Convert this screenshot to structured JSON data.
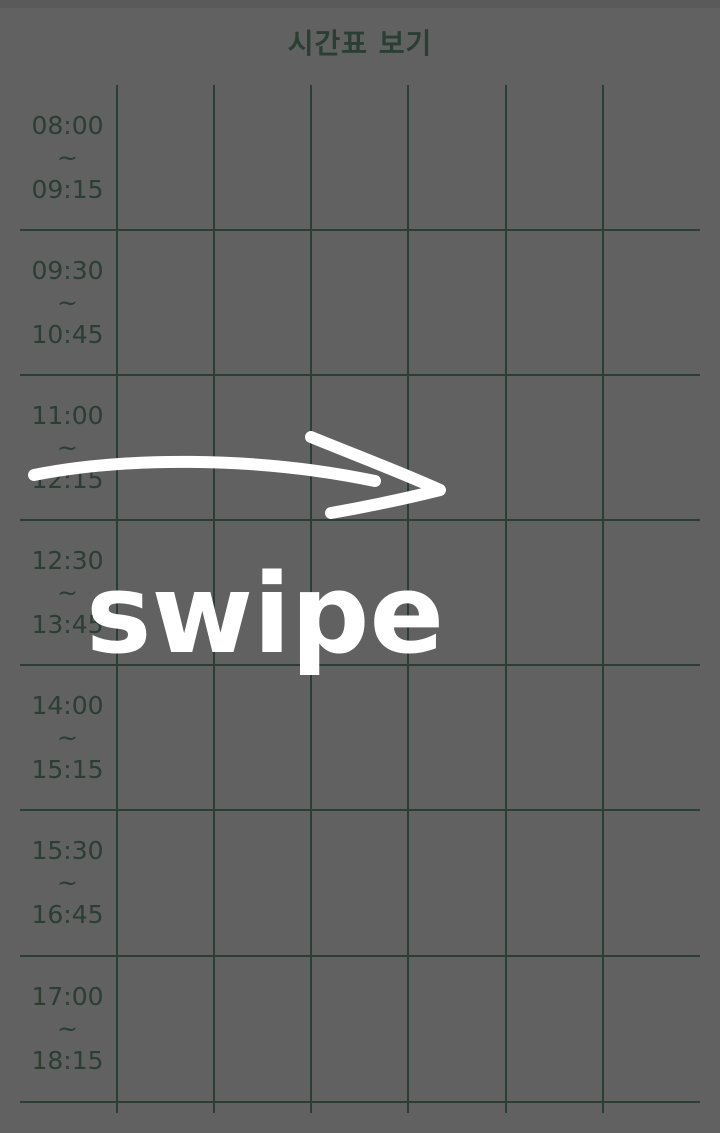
{
  "header": {
    "title": "시간표 보기"
  },
  "timetable": {
    "columns": 6,
    "slots": [
      {
        "start": "08:00",
        "sep": "~",
        "end": "09:15"
      },
      {
        "start": "09:30",
        "sep": "~",
        "end": "10:45"
      },
      {
        "start": "11:00",
        "sep": "~",
        "end": "12:15"
      },
      {
        "start": "12:30",
        "sep": "~",
        "end": "13:45"
      },
      {
        "start": "14:00",
        "sep": "~",
        "end": "15:15"
      },
      {
        "start": "15:30",
        "sep": "~",
        "end": "16:45"
      },
      {
        "start": "17:00",
        "sep": "~",
        "end": "18:15"
      }
    ]
  },
  "overlay": {
    "hint_text": "swipe",
    "arrow_icon": "swipe-right-arrow-icon",
    "hint_color": "#ffffff"
  },
  "colors": {
    "background": "#616161",
    "grid_line": "#2b3e34",
    "text": "#2b3e34"
  }
}
